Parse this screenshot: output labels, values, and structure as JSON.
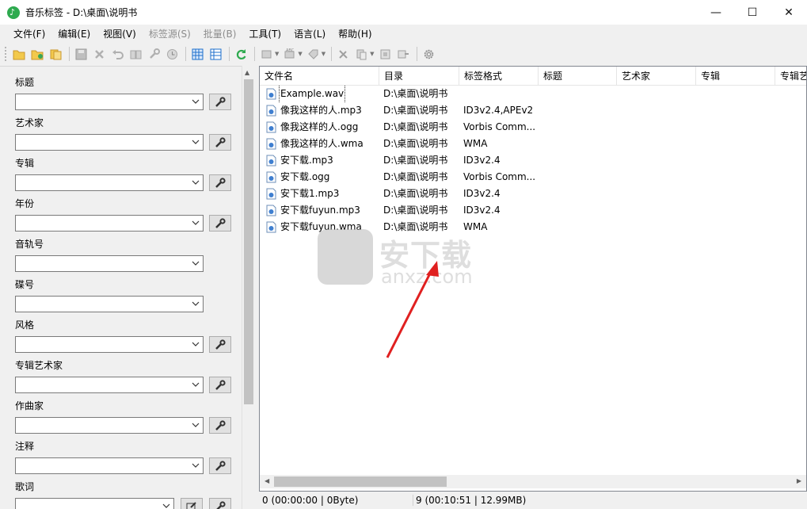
{
  "window": {
    "title": "音乐标签 - D:\\桌面\\说明书",
    "controls": {
      "minimize": "—",
      "maximize": "☐",
      "close": "✕"
    }
  },
  "menu": [
    {
      "label": "文件(F)",
      "enabled": true
    },
    {
      "label": "编辑(E)",
      "enabled": true
    },
    {
      "label": "视图(V)",
      "enabled": true
    },
    {
      "label": "标签源(S)",
      "enabled": false
    },
    {
      "label": "批量(B)",
      "enabled": false
    },
    {
      "label": "工具(T)",
      "enabled": true
    },
    {
      "label": "语言(L)",
      "enabled": true
    },
    {
      "label": "帮助(H)",
      "enabled": true
    }
  ],
  "fields": {
    "title": "标题",
    "artist": "艺术家",
    "album": "专辑",
    "year": "年份",
    "track": "音轨号",
    "disc": "碟号",
    "genre": "风格",
    "album_artist": "专辑艺术家",
    "composer": "作曲家",
    "comment": "注释",
    "lyrics": "歌词"
  },
  "list": {
    "columns": [
      "文件名",
      "目录",
      "标签格式",
      "标题",
      "艺术家",
      "专辑",
      "专辑艺"
    ],
    "rows": [
      {
        "name": "Example.wav",
        "dir": "D:\\桌面\\说明书",
        "format": ""
      },
      {
        "name": "像我这样的人.mp3",
        "dir": "D:\\桌面\\说明书",
        "format": "ID3v2.4,APEv2"
      },
      {
        "name": "像我这样的人.ogg",
        "dir": "D:\\桌面\\说明书",
        "format": "Vorbis Comm..."
      },
      {
        "name": "像我这样的人.wma",
        "dir": "D:\\桌面\\说明书",
        "format": "WMA"
      },
      {
        "name": "安下载.mp3",
        "dir": "D:\\桌面\\说明书",
        "format": "ID3v2.4"
      },
      {
        "name": "安下载.ogg",
        "dir": "D:\\桌面\\说明书",
        "format": "Vorbis Comm..."
      },
      {
        "name": "安下载1.mp3",
        "dir": "D:\\桌面\\说明书",
        "format": "ID3v2.4"
      },
      {
        "name": "安下载fuyun.mp3",
        "dir": "D:\\桌面\\说明书",
        "format": "ID3v2.4"
      },
      {
        "name": "安下载fuyun.wma",
        "dir": "D:\\桌面\\说明书",
        "format": "WMA"
      }
    ]
  },
  "status": {
    "selected": "0 (00:00:00 | 0Byte)",
    "total": "9 (00:10:51 | 12.99MB)"
  },
  "watermark": {
    "main": "安下载",
    "sub": "anxz.com",
    "logo": "安"
  },
  "colors": {
    "accent": "#2eaa4f",
    "arrow": "#e02020",
    "toolbar_blue": "#1e6fcc"
  }
}
